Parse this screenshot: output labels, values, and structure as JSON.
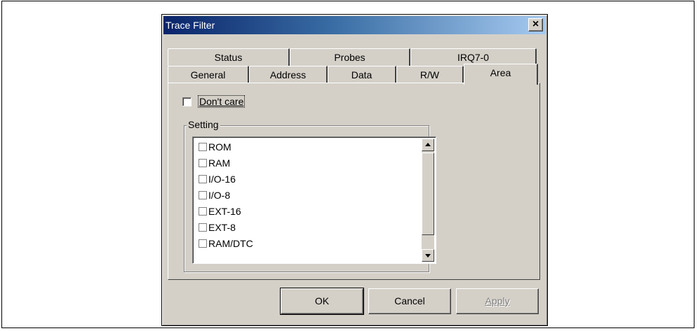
{
  "dialog": {
    "title": "Trace Filter",
    "close_symbol": "×"
  },
  "tabs": {
    "back_row": [
      "Status",
      "Probes",
      "IRQ7-0"
    ],
    "front_row": [
      "General",
      "Address",
      "Data",
      "R/W",
      "Area"
    ],
    "active": "Area"
  },
  "area": {
    "dont_care_label": "Don't care",
    "dont_care_checked": false,
    "group_label": "Setting",
    "items": [
      "ROM",
      "RAM",
      "I/O-16",
      "I/O-8",
      "EXT-16",
      "EXT-8",
      "RAM/DTC"
    ]
  },
  "buttons": {
    "ok": "OK",
    "cancel": "Cancel",
    "apply": "Apply"
  }
}
